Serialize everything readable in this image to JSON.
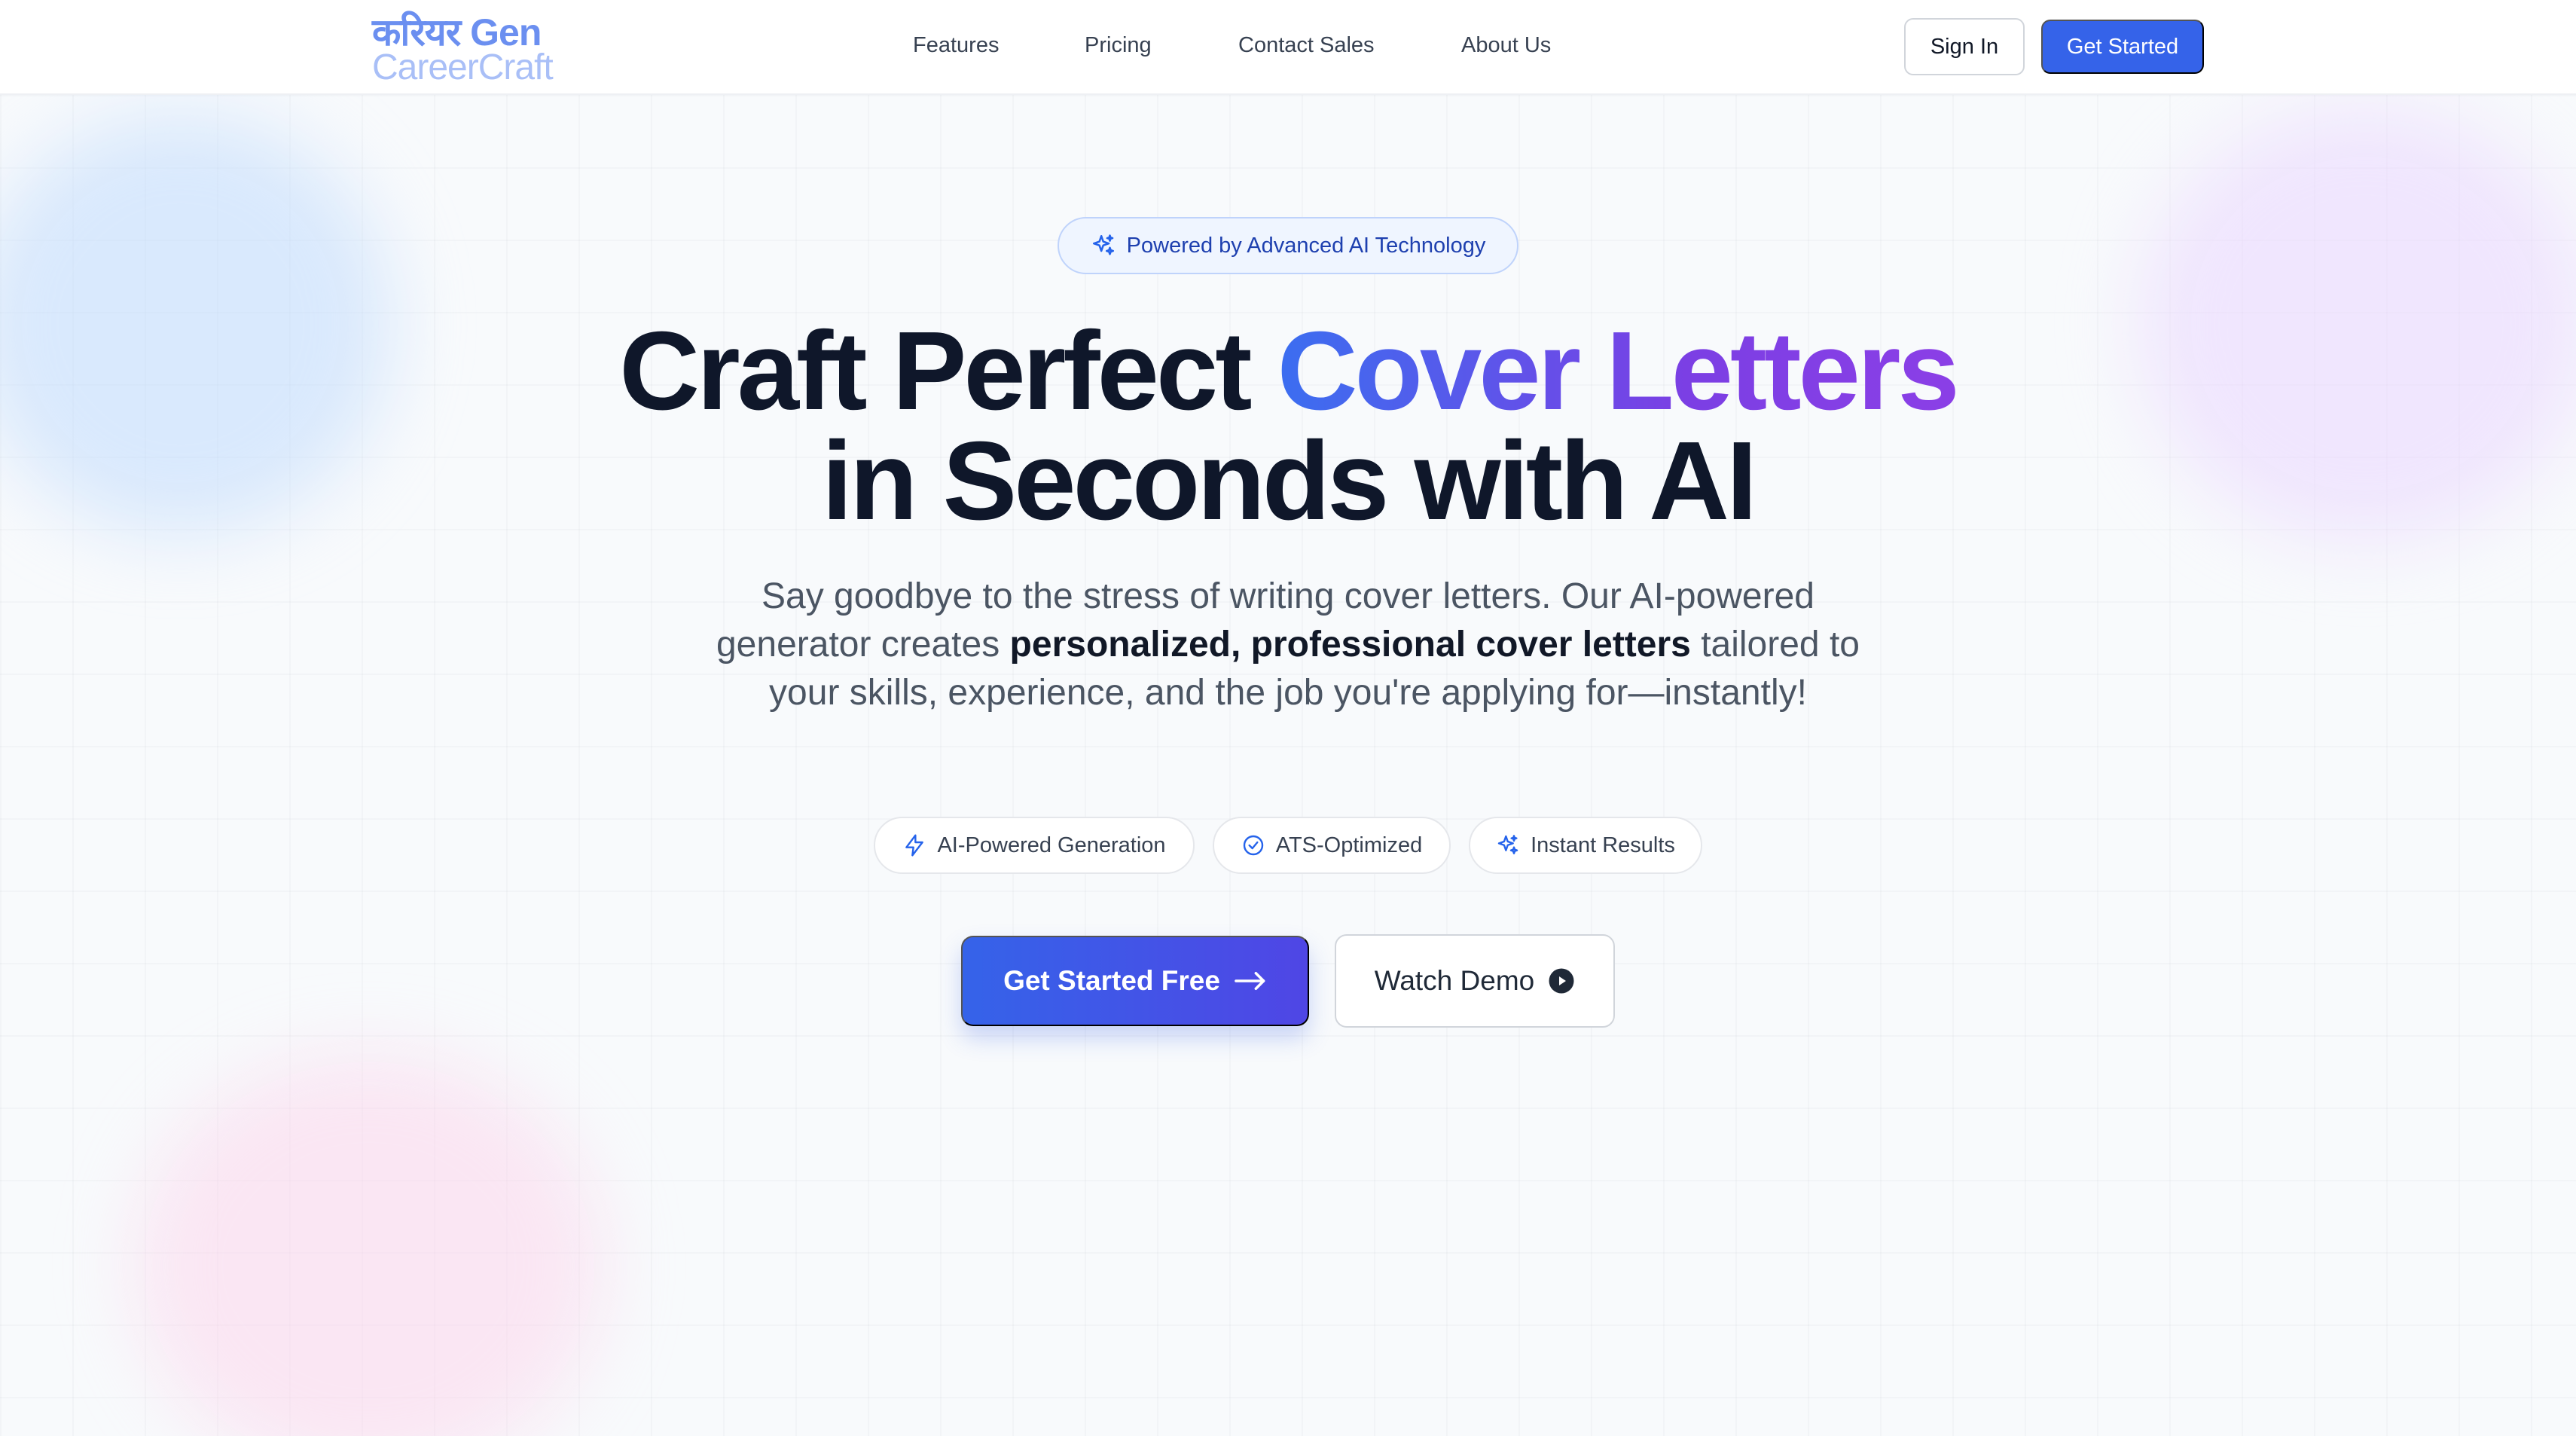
{
  "header": {
    "logo_line1": "करियर Gen",
    "logo_line2": "CareerCraft",
    "nav": [
      "Features",
      "Pricing",
      "Contact Sales",
      "About Us"
    ],
    "sign_in": "Sign In",
    "get_started": "Get Started"
  },
  "hero": {
    "badge": "Powered by Advanced AI Technology",
    "headline_part1": "Craft Perfect ",
    "headline_highlight": "Cover Letters",
    "headline_part2": "in Seconds with AI",
    "subtitle_part1": "Say goodbye to the stress of writing cover letters. Our AI-powered generator creates ",
    "subtitle_bold": "personalized, professional cover letters",
    "subtitle_part2": " tailored to your skills, experience, and the job you're applying for—instantly!",
    "chips": [
      {
        "label": "AI-Powered Generation",
        "icon": "lightning-icon"
      },
      {
        "label": "ATS-Optimized",
        "icon": "check-circle-icon"
      },
      {
        "label": "Instant Results",
        "icon": "sparkles-icon"
      }
    ],
    "cta_primary": "Get Started Free",
    "cta_secondary": "Watch Demo"
  },
  "colors": {
    "brand_blue": "#3563e9",
    "gradient_start": "#3b6ef0",
    "gradient_end": "#8b3fe6",
    "logo_primary": "#6b8ff0",
    "logo_secondary": "#a9bff7"
  }
}
